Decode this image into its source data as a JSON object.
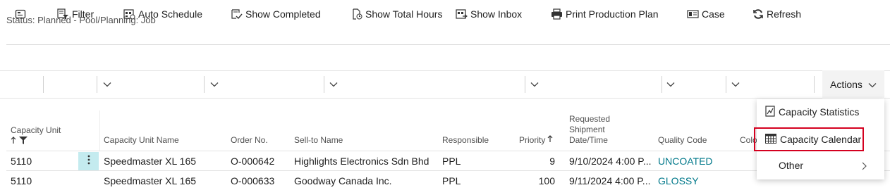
{
  "status_line": "Status: Planned - Pool/Planning: Job",
  "toolbar": {
    "filter": "Filter",
    "auto_schedule": "Auto Schedule",
    "show_completed": "Show Completed",
    "show_total_hours": "Show Total Hours",
    "show_inbox": "Show Inbox",
    "print_production_plan": "Print Production Plan",
    "case": "Case",
    "refresh": "Refresh",
    "actions": "Actions"
  },
  "columns": {
    "capacity_unit": "Capacity Unit",
    "capacity_unit_name": "Capacity Unit Name",
    "order_no": "Order No.",
    "sell_to_name": "Sell-to Name",
    "responsible": "Responsible",
    "priority": "Priority",
    "requested_shipment_1": "Requested",
    "requested_shipment_2": "Shipment",
    "requested_shipment_3": "Date/Time",
    "quality_code": "Quality Code",
    "color_partial": "Colo"
  },
  "rows": [
    {
      "capacity_unit": "5110",
      "capacity_unit_name": "Speedmaster XL 165",
      "order_no": "O-000642",
      "sell_to_name": "Highlights Electronics Sdn Bhd",
      "responsible": "PPL",
      "priority": "9",
      "requested_shipment": "9/10/2024 4:00 P...",
      "quality_code": "UNCOATED"
    },
    {
      "capacity_unit": "5110",
      "capacity_unit_name": "Speedmaster XL 165",
      "order_no": "O-000633",
      "sell_to_name": "Goodway Canada Inc.",
      "responsible": "PPL",
      "priority": "100",
      "requested_shipment": "9/11/2024 4:00 P...",
      "quality_code": "GLOSSY"
    }
  ],
  "actions_menu": {
    "items": [
      {
        "label": "Capacity Statistics",
        "icon": "chart-icon"
      },
      {
        "label": "Capacity Calendar",
        "icon": "calendar-grid-icon",
        "highlighted": true
      },
      {
        "label": "Other",
        "icon": "chevron-right-icon"
      }
    ]
  },
  "colors": {
    "accent_teal": "#00788a",
    "selection_cell": "#c4ebef",
    "highlight_box": "#d4001f"
  }
}
